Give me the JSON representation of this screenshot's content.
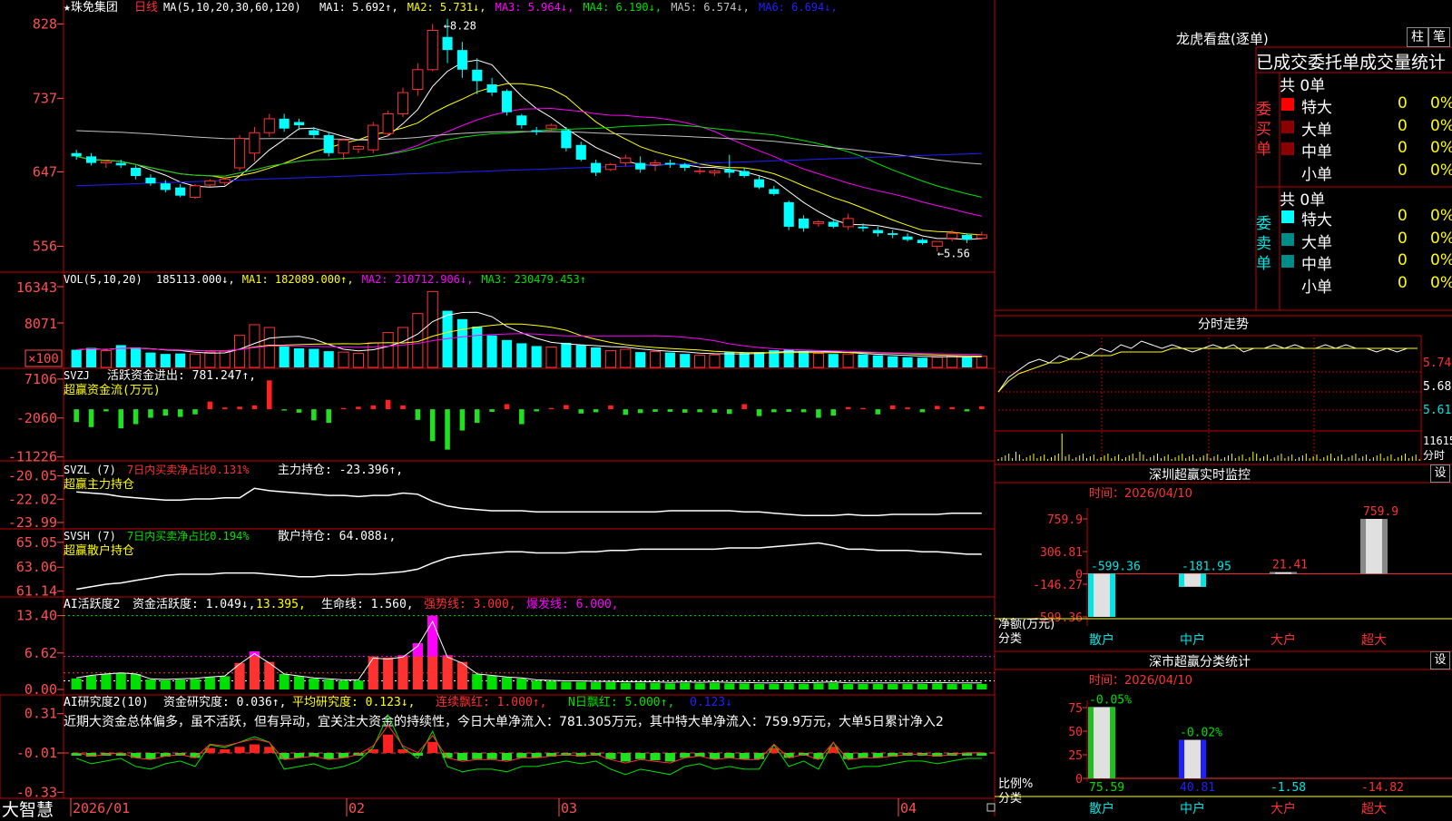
{
  "stock": {
    "name": "珠免集团",
    "period": "日线",
    "star": "★"
  },
  "colors": {
    "up": "#ff3232",
    "down": "#00ffff",
    "grid": "#c00000",
    "axis": "#ff5050",
    "yellow": "#ffff00",
    "magenta": "#ff00ff",
    "green": "#00e000",
    "blue": "#2020ff",
    "white": "#ffffff"
  },
  "date_ticks": [
    "2026/01",
    "02",
    "03",
    "04"
  ],
  "logo": "大智慧",
  "chart_data": [
    {
      "type": "candlestick",
      "title_prefix": "MA(5,10,20,30,60,120)",
      "legend": [
        {
          "name": "MA1:",
          "value": "5.692",
          "arrow": "↑"
        },
        {
          "name": "MA2:",
          "value": "5.731",
          "arrow": "↓"
        },
        {
          "name": "MA3:",
          "value": "5.964",
          "arrow": "↓"
        },
        {
          "name": "MA4:",
          "value": "6.190",
          "arrow": "↓"
        },
        {
          "name": "MA5:",
          "value": "6.574",
          "arrow": "↓"
        },
        {
          "name": "MA6:",
          "value": "6.694",
          "arrow": "↓"
        }
      ],
      "yticks": [
        "828",
        "737",
        "647",
        "556"
      ],
      "ylim": [
        5.3,
        8.35
      ],
      "annotations": {
        "high": "8.28",
        "low": "←5.56"
      },
      "ohlc": [
        [
          6.7,
          6.74,
          6.62,
          6.66
        ],
        [
          6.66,
          6.7,
          6.55,
          6.58
        ],
        [
          6.58,
          6.62,
          6.52,
          6.6
        ],
        [
          6.58,
          6.62,
          6.52,
          6.55
        ],
        [
          6.52,
          6.55,
          6.38,
          6.42
        ],
        [
          6.4,
          6.44,
          6.3,
          6.33
        ],
        [
          6.33,
          6.37,
          6.22,
          6.25
        ],
        [
          6.28,
          6.32,
          6.16,
          6.18
        ],
        [
          6.16,
          6.32,
          6.14,
          6.3
        ],
        [
          6.31,
          6.38,
          6.29,
          6.36
        ],
        [
          6.34,
          6.4,
          6.3,
          6.38
        ],
        [
          6.52,
          6.92,
          6.48,
          6.88
        ],
        [
          6.7,
          7.02,
          6.6,
          6.95
        ],
        [
          6.95,
          7.18,
          6.9,
          7.12
        ],
        [
          7.12,
          7.18,
          6.96,
          7.0
        ],
        [
          7.08,
          7.12,
          6.98,
          7.04
        ],
        [
          6.98,
          7.02,
          6.88,
          6.92
        ],
        [
          6.92,
          6.96,
          6.66,
          6.7
        ],
        [
          6.7,
          6.88,
          6.62,
          6.86
        ],
        [
          6.75,
          6.8,
          6.7,
          6.78
        ],
        [
          6.74,
          7.08,
          6.7,
          7.04
        ],
        [
          6.94,
          7.22,
          6.9,
          7.18
        ],
        [
          7.18,
          7.5,
          7.14,
          7.44
        ],
        [
          7.48,
          7.8,
          7.4,
          7.72
        ],
        [
          7.72,
          8.28,
          7.7,
          8.2
        ],
        [
          8.12,
          8.34,
          7.8,
          7.96
        ],
        [
          7.96,
          8.06,
          7.62,
          7.72
        ],
        [
          7.72,
          7.86,
          7.42,
          7.58
        ],
        [
          7.54,
          7.62,
          7.4,
          7.44
        ],
        [
          7.46,
          7.48,
          7.16,
          7.2
        ],
        [
          7.16,
          7.18,
          7.0,
          7.04
        ],
        [
          6.98,
          7.02,
          6.92,
          6.96
        ],
        [
          7.0,
          7.06,
          6.96,
          7.04
        ],
        [
          6.98,
          7.02,
          6.72,
          6.76
        ],
        [
          6.8,
          6.84,
          6.6,
          6.62
        ],
        [
          6.58,
          6.62,
          6.42,
          6.46
        ],
        [
          6.5,
          6.58,
          6.48,
          6.56
        ],
        [
          6.58,
          6.68,
          6.54,
          6.64
        ],
        [
          6.58,
          6.66,
          6.46,
          6.5
        ],
        [
          6.56,
          6.62,
          6.48,
          6.58
        ],
        [
          6.58,
          6.62,
          6.52,
          6.56
        ],
        [
          6.56,
          6.58,
          6.48,
          6.52
        ],
        [
          6.48,
          6.52,
          6.44,
          6.48
        ],
        [
          6.46,
          6.5,
          6.42,
          6.48
        ],
        [
          6.5,
          6.68,
          6.4,
          6.46
        ],
        [
          6.48,
          6.52,
          6.4,
          6.42
        ],
        [
          6.38,
          6.42,
          6.26,
          6.28
        ],
        [
          6.26,
          6.3,
          6.18,
          6.2
        ],
        [
          6.1,
          6.12,
          5.76,
          5.8
        ],
        [
          5.9,
          5.94,
          5.74,
          5.78
        ],
        [
          5.84,
          5.88,
          5.8,
          5.86
        ],
        [
          5.86,
          5.9,
          5.78,
          5.8
        ],
        [
          5.8,
          5.96,
          5.76,
          5.9
        ],
        [
          5.8,
          5.84,
          5.74,
          5.78
        ],
        [
          5.76,
          5.8,
          5.68,
          5.72
        ],
        [
          5.72,
          5.76,
          5.66,
          5.7
        ],
        [
          5.68,
          5.72,
          5.62,
          5.64
        ],
        [
          5.64,
          5.66,
          5.58,
          5.6
        ],
        [
          5.56,
          5.62,
          5.5,
          5.62
        ],
        [
          5.66,
          5.76,
          5.62,
          5.72
        ],
        [
          5.7,
          5.72,
          5.6,
          5.64
        ],
        [
          5.66,
          5.74,
          5.64,
          5.7
        ]
      ]
    },
    {
      "type": "bar",
      "name": "VOL(5,10,20)",
      "legend": [
        {
          "name": "",
          "value": "185113.000",
          "arrow": "↓"
        },
        {
          "name": "MA1:",
          "value": "182089.000",
          "arrow": "↑"
        },
        {
          "name": "MA2:",
          "value": "210712.906",
          "arrow": "↓"
        },
        {
          "name": "MA3:",
          "value": "230479.453",
          "arrow": "↑"
        }
      ],
      "yticks": [
        "16343",
        "8071",
        "×100"
      ],
      "ylim": [
        0,
        17000
      ],
      "values": [
        3800,
        4200,
        3600,
        4800,
        4300,
        3200,
        2900,
        3000,
        2900,
        3300,
        3500,
        6900,
        9200,
        8600,
        4600,
        4100,
        4000,
        3500,
        3300,
        3000,
        5300,
        7500,
        8600,
        11600,
        16343,
        12200,
        10400,
        8800,
        6900,
        5900,
        5200,
        4600,
        4400,
        5300,
        4800,
        4300,
        3600,
        3900,
        3300,
        3400,
        3200,
        2900,
        2600,
        2700,
        3300,
        3100,
        3300,
        3700,
        3900,
        3400,
        3000,
        2900,
        2900,
        2800,
        2600,
        2400,
        2200,
        2100,
        2200,
        2500,
        2300,
        2400
      ]
    },
    {
      "type": "bar",
      "name": "SVZJ",
      "labels": [
        "活跃资金进出:",
        "781.247",
        "↑,",
        "超赢资金流(万元)"
      ],
      "yticks": [
        "7106",
        "-2060",
        "-11226"
      ],
      "ylim": [
        -11500,
        7500
      ],
      "values": [
        -3000,
        -4200,
        -500,
        -4500,
        -3500,
        -2000,
        -1500,
        -1800,
        -1200,
        1800,
        400,
        600,
        900,
        6800,
        -300,
        -800,
        -2600,
        -3200,
        300,
        600,
        900,
        2200,
        900,
        -2500,
        -7500,
        -9500,
        -5000,
        -3200,
        -600,
        1200,
        -3500,
        -500,
        300,
        1000,
        -1000,
        -700,
        900,
        -1300,
        -900,
        -600,
        -600,
        -800,
        -700,
        -800,
        -1100,
        1200,
        -1600,
        -700,
        -600,
        -700,
        -2000,
        -1500,
        500,
        300,
        -1200,
        900,
        400,
        -700,
        800,
        500,
        -500,
        700
      ]
    },
    {
      "type": "line",
      "name": "SVZL (7)",
      "labels": [
        "7日内买卖净占比0.131%",
        "主力持仓:",
        "-23.396",
        "↑,",
        "超赢主力持仓"
      ],
      "yticks": [
        "-20.05",
        "-22.02",
        "-23.99"
      ],
      "ylim": [
        -24.3,
        -19.7
      ],
      "values": [
        -21.4,
        -21.5,
        -21.6,
        -21.8,
        -21.9,
        -22.0,
        -22.1,
        -22.1,
        -22.0,
        -22.0,
        -21.9,
        -21.9,
        -21.1,
        -21.3,
        -21.4,
        -21.5,
        -21.6,
        -21.7,
        -21.7,
        -21.8,
        -21.7,
        -21.7,
        -21.5,
        -21.6,
        -22.2,
        -22.6,
        -22.8,
        -22.9,
        -23.0,
        -23.0,
        -23.0,
        -23.1,
        -23.1,
        -23.1,
        -23.1,
        -23.1,
        -23.1,
        -23.1,
        -23.1,
        -23.1,
        -23.0,
        -23.0,
        -23.0,
        -23.0,
        -23.0,
        -23.1,
        -23.1,
        -23.2,
        -23.3,
        -23.4,
        -23.4,
        -23.4,
        -23.3,
        -23.4,
        -23.4,
        -23.3,
        -23.3,
        -23.3,
        -23.3,
        -23.2,
        -23.2,
        -23.2
      ]
    },
    {
      "type": "line",
      "name": "SVSH (7)",
      "labels": [
        "7日内买卖净占比0.194%",
        "散户持仓:",
        "64.088",
        "↓,",
        "超赢散户持仓"
      ],
      "yticks": [
        "65.05",
        "63.06",
        "61.14"
      ],
      "ylim": [
        60.9,
        65.4
      ],
      "values": [
        61.3,
        61.5,
        61.7,
        61.8,
        62.0,
        62.2,
        62.4,
        62.5,
        62.5,
        62.5,
        62.6,
        62.6,
        62.6,
        62.5,
        62.4,
        62.3,
        62.3,
        62.4,
        62.4,
        62.5,
        62.5,
        62.6,
        62.7,
        62.9,
        63.4,
        63.8,
        64.0,
        64.1,
        64.2,
        64.3,
        64.3,
        64.2,
        64.2,
        64.2,
        64.3,
        64.3,
        64.4,
        64.4,
        64.5,
        64.5,
        64.5,
        64.5,
        64.5,
        64.5,
        64.6,
        64.6,
        64.6,
        64.7,
        64.8,
        64.9,
        65.0,
        64.8,
        64.5,
        64.5,
        64.4,
        64.4,
        64.4,
        64.3,
        64.3,
        64.2,
        64.1,
        64.1
      ]
    },
    {
      "type": "bar",
      "name": "AI活跃度2",
      "labels": [
        "资金活跃度:",
        "1.049",
        "↓,",
        "13.395",
        ",",
        "生命线:",
        "1.560",
        ",",
        "强势线:",
        "3.000",
        ",",
        "爆发线:",
        "6.000",
        ","
      ],
      "yticks": [
        "13.40",
        "6.62",
        "0.00"
      ],
      "ylim": [
        0,
        14
      ],
      "values": [
        2.0,
        2.5,
        2.8,
        3.0,
        2.8,
        1.8,
        1.7,
        1.8,
        1.9,
        2.2,
        2.4,
        4.8,
        6.9,
        5.0,
        2.8,
        2.4,
        2.0,
        1.8,
        1.6,
        1.6,
        6.0,
        5.8,
        6.2,
        8.4,
        13.4,
        6.2,
        5.0,
        2.8,
        2.5,
        2.2,
        2.0,
        1.6,
        1.5,
        1.4,
        1.4,
        1.3,
        1.3,
        1.2,
        1.2,
        1.2,
        1.1,
        1.2,
        1.1,
        1.2,
        1.1,
        1.1,
        1.0,
        1.0,
        1.1,
        1.0,
        1.1,
        1.2,
        1.0,
        1.0,
        1.0,
        1.0,
        1.0,
        1.0,
        1.1,
        1.0,
        1.0,
        1.0
      ],
      "lines": {
        "life": 1.56,
        "strong": 3.0,
        "burst": 6.0,
        "top": 13.395
      }
    },
    {
      "type": "bar",
      "name": "AI研究度2(10)",
      "labels": [
        "资金研究度:",
        "0.036",
        "↑,",
        "平均研究度:",
        "0.123",
        "↓,",
        "连续飘红:",
        "1.000",
        "↑,",
        "N日飘红:",
        "5.000",
        "↑,",
        "0.123",
        "↓"
      ],
      "note": "近期大资金总体偏多，虽不活跃，但有异动，宜关注大资金的持续性，今日大单净流入：781.305万元，其中特大单净流入：759.9万元，大单5日累计净入2",
      "yticks": [
        "0.31",
        "-0.01",
        "-0.33"
      ],
      "ylim": [
        -0.35,
        0.33
      ],
      "values": [
        -0.02,
        -0.04,
        -0.03,
        -0.02,
        -0.05,
        -0.06,
        -0.04,
        -0.03,
        -0.05,
        0.03,
        0.02,
        0.04,
        0.06,
        0.04,
        -0.06,
        -0.05,
        -0.04,
        -0.06,
        -0.05,
        -0.03,
        0.02,
        0.14,
        0.02,
        -0.02,
        0.08,
        -0.05,
        -0.07,
        -0.06,
        -0.06,
        -0.07,
        -0.05,
        -0.05,
        -0.04,
        -0.03,
        -0.04,
        -0.03,
        -0.06,
        -0.08,
        -0.06,
        -0.07,
        -0.08,
        -0.05,
        -0.04,
        -0.06,
        -0.05,
        -0.06,
        -0.06,
        0.03,
        -0.05,
        -0.03,
        -0.06,
        0.04,
        -0.06,
        -0.05,
        -0.05,
        -0.04,
        -0.03,
        -0.03,
        -0.04,
        -0.03,
        -0.02,
        -0.02
      ]
    },
    {
      "type": "line",
      "name": "分时走势",
      "yticks": [
        "5.74",
        "5.68",
        "5.61",
        "11615",
        "分时"
      ],
      "ylim": [
        5.57,
        5.77
      ],
      "values": [
        5.62,
        5.66,
        5.68,
        5.7,
        5.71,
        5.7,
        5.72,
        5.71,
        5.73,
        5.72,
        5.74,
        5.73,
        5.75,
        5.74,
        5.76,
        5.75,
        5.74,
        5.75,
        5.74,
        5.73,
        5.74,
        5.75,
        5.74,
        5.75,
        5.73,
        5.74,
        5.74,
        5.75,
        5.74,
        5.75,
        5.74,
        5.74,
        5.75,
        5.74,
        5.75,
        5.74,
        5.74,
        5.73,
        5.74,
        5.73,
        5.74,
        5.74
      ],
      "avg": [
        5.62,
        5.65,
        5.67,
        5.68,
        5.69,
        5.7,
        5.7,
        5.71,
        5.71,
        5.72,
        5.72,
        5.72,
        5.73,
        5.73,
        5.73,
        5.73,
        5.73,
        5.74,
        5.74,
        5.74,
        5.74,
        5.74,
        5.74,
        5.74,
        5.74,
        5.74,
        5.74,
        5.74,
        5.74,
        5.74,
        5.74,
        5.74,
        5.74,
        5.74,
        5.74,
        5.74,
        5.74,
        5.74,
        5.74,
        5.74,
        5.74,
        5.74
      ]
    },
    {
      "type": "bar",
      "name": "深圳超赢实时监控",
      "time_label": "时间：2026/04/10",
      "yticks": [
        "759.9",
        "306.81",
        "0",
        "-146.27",
        "-599.36"
      ],
      "ylabel": "净额(万元)",
      "xlabel": "分类",
      "categories": [
        "散户",
        "中户",
        "大户",
        "超大"
      ],
      "values": [
        -599.36,
        -181.95,
        21.41,
        759.9
      ],
      "value_labels": [
        "-599.36",
        "-181.95",
        "21.41",
        "759.9"
      ]
    },
    {
      "type": "bar",
      "name": "深市超赢分类统计",
      "time_label": "时间：2026/04/10",
      "yticks": [
        "75",
        "50",
        "25",
        "0"
      ],
      "ylabel": "比例%",
      "xlabel": "分类",
      "categories": [
        "散户",
        "中户",
        "大户",
        "超大"
      ],
      "values": [
        75.59,
        40.81,
        -1.58,
        -14.82
      ],
      "value_labels": [
        "75.59",
        "40.81",
        "-1.58",
        "-14.82"
      ],
      "top_labels": [
        "-0.05%",
        "-0.02%"
      ]
    }
  ],
  "dragon": {
    "title": "龙虎看盘(逐单)",
    "btn1": "柱",
    "btn2": "笔",
    "header": "已成交委托单成交量统计",
    "buy": {
      "side": "委买单",
      "count": "共 0单",
      "rows": [
        {
          "label": "特大",
          "v": "0",
          "p": "0%"
        },
        {
          "label": "大单",
          "v": "0",
          "p": "0%"
        },
        {
          "label": "中单",
          "v": "0",
          "p": "0%"
        },
        {
          "label": "小单",
          "v": "0",
          "p": "0%"
        }
      ]
    },
    "sell": {
      "side": "委卖单",
      "count": "共 0单",
      "rows": [
        {
          "label": "特大",
          "v": "0",
          "p": "0%"
        },
        {
          "label": "大单",
          "v": "0",
          "p": "0%"
        },
        {
          "label": "中单",
          "v": "0",
          "p": "0%"
        },
        {
          "label": "小单",
          "v": "0",
          "p": "0%"
        }
      ]
    }
  },
  "set_label": "设"
}
